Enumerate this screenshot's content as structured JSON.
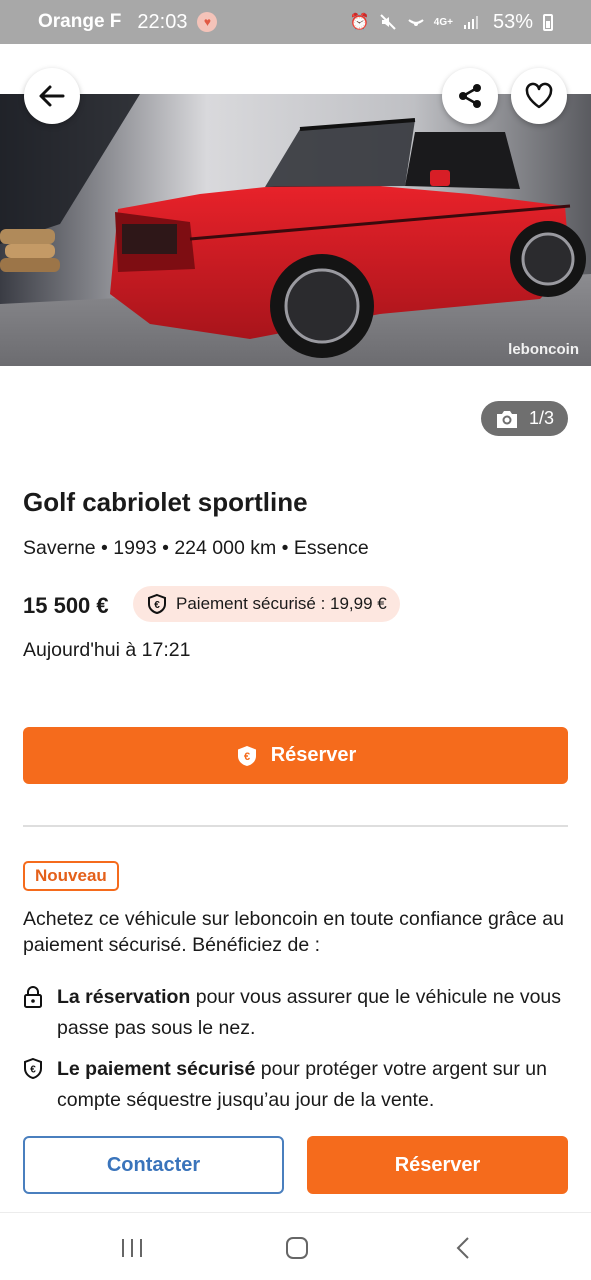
{
  "status_bar": {
    "carrier": "Orange F",
    "time": "22:03",
    "network": "4G+",
    "battery": "53%"
  },
  "listing": {
    "photo_counter": "1/3",
    "watermark": "leboncoin",
    "title": "Golf cabriolet sportline",
    "details": "Saverne • 1993 • 224 000 km • Essence",
    "price": "15 500 €",
    "secure_payment": "Paiement sécurisé : 19,99 €",
    "posted": "Aujourd'hui à 17:21",
    "reserve_label": "Réserver"
  },
  "promo": {
    "badge": "Nouveau",
    "intro": "Achetez ce véhicule sur leboncoin en toute confiance grâce au paiement sécurisé. Bénéficiez de :",
    "features": [
      {
        "bold": "La réservation",
        "text": " pour vous assurer que le véhicule ne vous passe pas sous le nez.",
        "icon": "lock-icon"
      },
      {
        "bold": "Le paiement sécurisé",
        "text": " pour protéger votre argent sur un compte séquestre jusqu’au jour de la vente.",
        "icon": "euro-shield-icon"
      }
    ]
  },
  "actions": {
    "contact_label": "Contacter",
    "reserve_label": "Réserver"
  },
  "colors": {
    "accent": "#f56b1c",
    "link_blue": "#3a74bb",
    "chip_bg": "#fde7e0"
  }
}
